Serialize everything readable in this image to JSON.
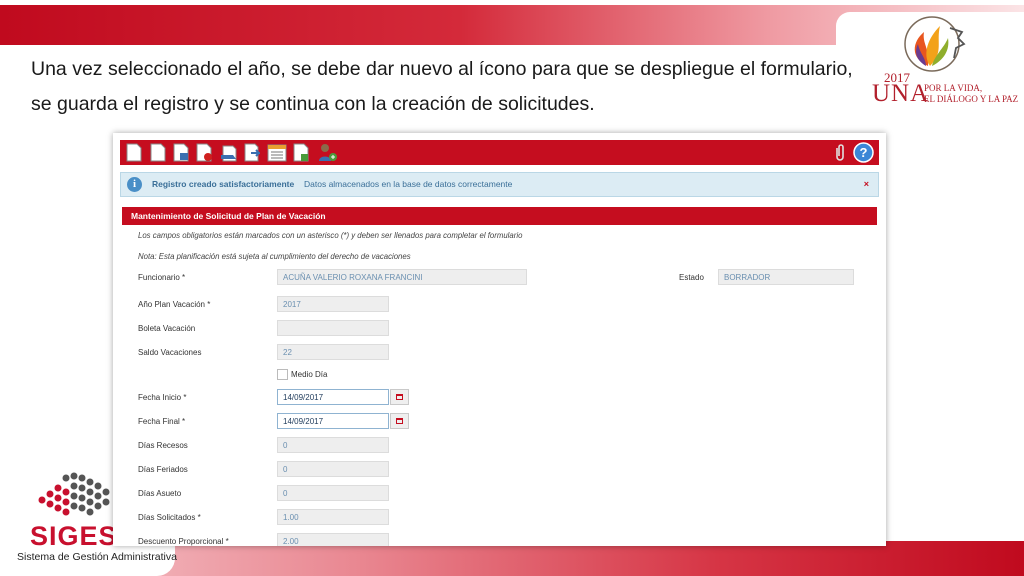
{
  "slide": {
    "caption_line1": "Una vez seleccionado el año, se debe dar nuevo al ícono para que se despliegue el formulario,",
    "caption_line2": "se guarda el registro y se continua con la creación de solicitudes.",
    "una_logo": {
      "year": "2017",
      "word": "UNA",
      "tagline1": "POR LA VIDA,",
      "tagline2": "EL DIÁLOGO Y LA PAZ"
    },
    "sigesa_logo": {
      "word": "SIGESA",
      "subtitle": "Sistema de Gestión Administrativa"
    },
    "colors": {
      "brand_red": "#c50d1f",
      "info_bg": "#dcecf4",
      "info_text": "#3a6f98"
    }
  },
  "toolbar": {
    "icons": [
      "new-document-icon",
      "blank-page-icon",
      "save-document-icon",
      "delete-document-icon",
      "print-icon",
      "export-icon",
      "calendar-list-icon",
      "report-icon",
      "add-user-icon"
    ],
    "right_icons": [
      "attachment-icon",
      "help-icon"
    ]
  },
  "alert": {
    "title": "Registro creado satisfactoriamente",
    "message": "Datos almacenados en la base de datos correctamente",
    "close": "×"
  },
  "panel": {
    "title": "Mantenimiento de Solicitud de Plan de Vacación",
    "note_required": "Los campos obligatorios están marcados con un asterisco (*) y deben ser llenados para completar el formulario",
    "note_plan": "Nota: Esta planificación está sujeta al cumplimiento del derecho de vacaciones"
  },
  "form": {
    "funcionario_label": "Funcionario *",
    "funcionario_value": "ACUÑA  VALERIO ROXANA FRANCINI",
    "estado_label": "Estado",
    "estado_value": "BORRADOR",
    "anio_label": "Año Plan Vacación *",
    "anio_value": "2017",
    "boleta_label": "Boleta Vacación",
    "boleta_value": "",
    "saldo_label": "Saldo Vacaciones",
    "saldo_value": "22",
    "medio_dia_label": "Medio Día",
    "fecha_inicio_label": "Fecha Inicio *",
    "fecha_inicio_value": "14/09/2017",
    "fecha_final_label": "Fecha Final *",
    "fecha_final_value": "14/09/2017",
    "recesos_label": "Días Recesos",
    "recesos_value": "0",
    "feriados_label": "Días Feriados",
    "feriados_value": "0",
    "asueto_label": "Días Asueto",
    "asueto_value": "0",
    "solicitados_label": "Días Solicitados *",
    "solicitados_value": "1.00",
    "descuento_label": "Descuento Proporcional *",
    "descuento_value": "2.00"
  }
}
